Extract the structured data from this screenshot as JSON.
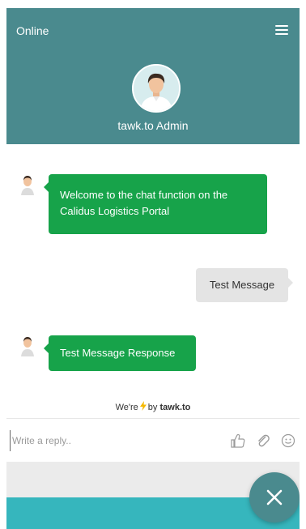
{
  "header": {
    "status": "Online",
    "agent_name": "tawk.to Admin",
    "menu_icon": "hamburger-menu-icon",
    "background": "#4a8a8e"
  },
  "messages": [
    {
      "sender": "agent",
      "text_line1": "Welcome to the chat function on the",
      "text_line2": "Calidus Logistics Portal"
    },
    {
      "sender": "visitor",
      "text": "Test Message"
    },
    {
      "sender": "agent",
      "text": "Test Message Response"
    }
  ],
  "footer": {
    "powered_prefix": "We're",
    "powered_middle": "by",
    "powered_brand": "tawk.to",
    "reply_placeholder": "Write a reply..",
    "icons": [
      "thumbs-up-icon",
      "paperclip-icon",
      "smiley-icon"
    ]
  },
  "colors": {
    "agent_bubble": "#17a34a",
    "visitor_bubble": "#e4e4e4",
    "bottom_bar": "#36b6bd"
  },
  "fab": {
    "icon": "close-icon"
  }
}
